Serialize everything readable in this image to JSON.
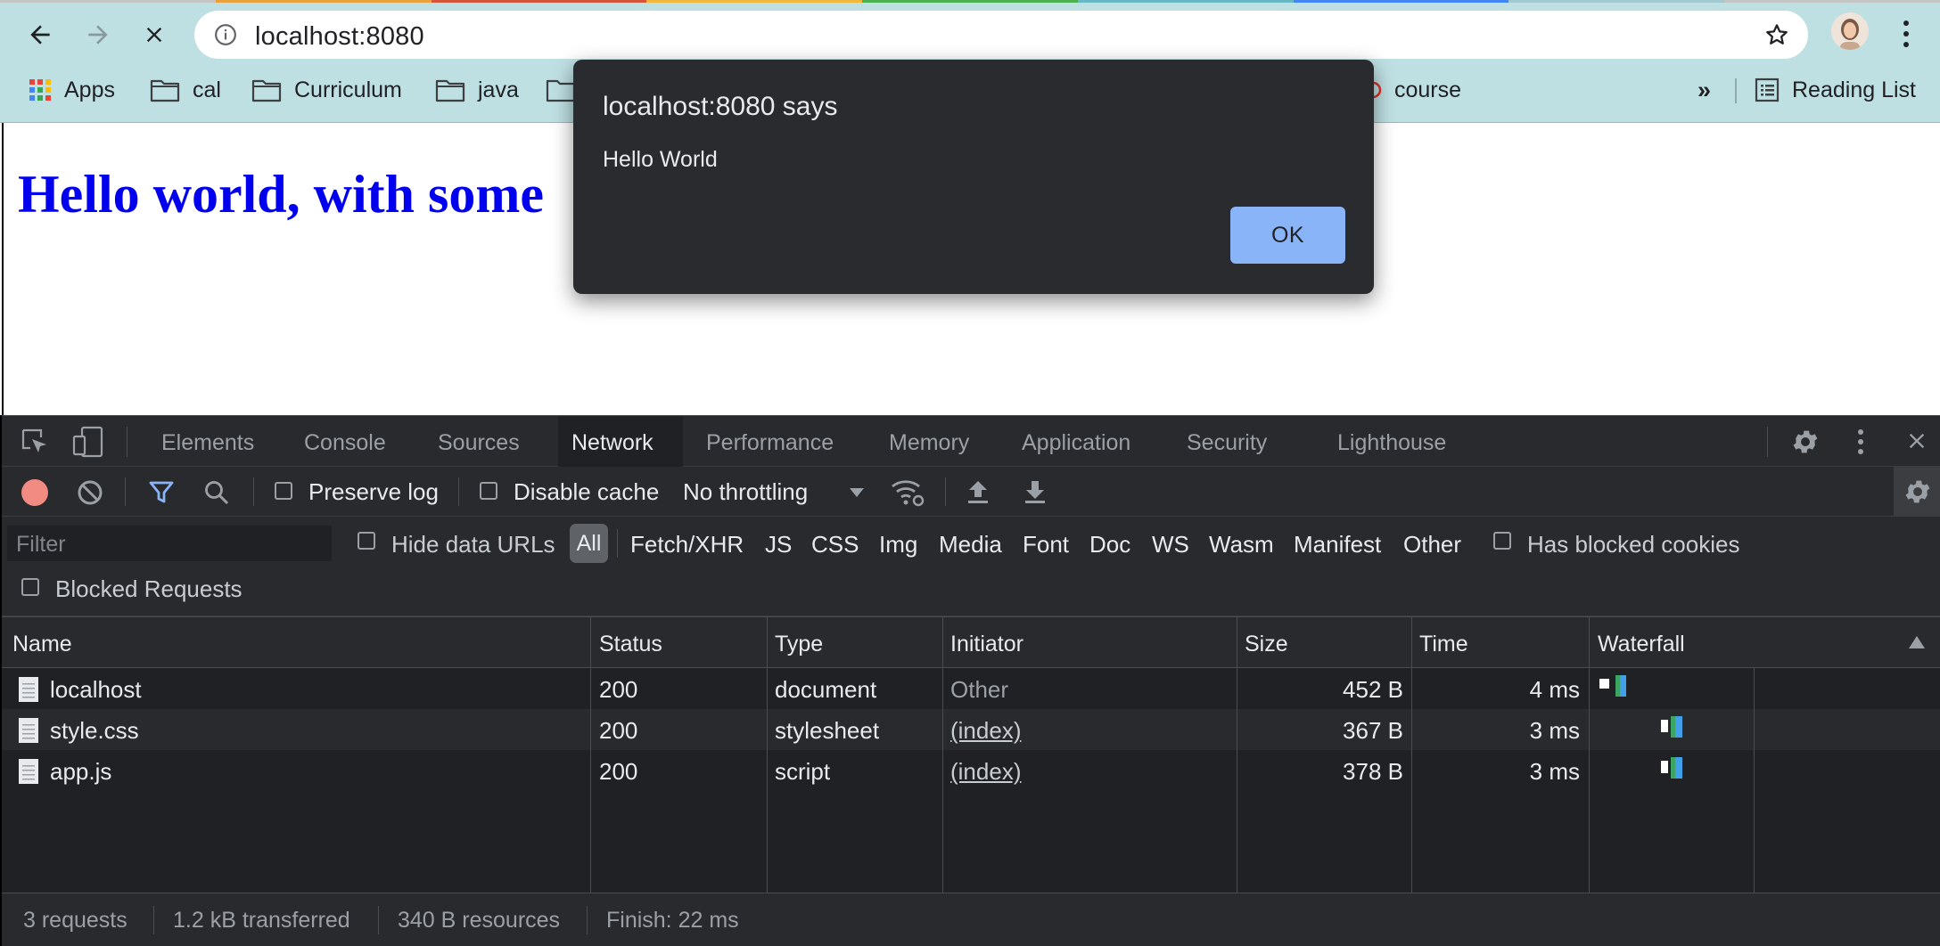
{
  "browser": {
    "url": "localhost:8080",
    "bookmarks": [
      {
        "label": "Apps",
        "icon": "apps-grid-icon"
      },
      {
        "label": "cal",
        "icon": "folder-icon"
      },
      {
        "label": "Curriculum",
        "icon": "folder-icon"
      },
      {
        "label": "java",
        "icon": "folder-icon"
      },
      {
        "label": "course",
        "icon": "bookmark-favicon"
      }
    ],
    "overflow_label": "»",
    "reading_list_label": "Reading List"
  },
  "page": {
    "heading": "Hello world, with some"
  },
  "alert": {
    "title": "localhost:8080 says",
    "message": "Hello World",
    "ok_label": "OK"
  },
  "devtools": {
    "tabs": [
      "Elements",
      "Console",
      "Sources",
      "Network",
      "Performance",
      "Memory",
      "Application",
      "Security",
      "Lighthouse"
    ],
    "active_tab": "Network",
    "toolbar": {
      "preserve_log": "Preserve log",
      "disable_cache": "Disable cache",
      "throttling": "No throttling"
    },
    "filter": {
      "placeholder": "Filter",
      "hide_data_urls": "Hide data URLs",
      "types": [
        "All",
        "Fetch/XHR",
        "JS",
        "CSS",
        "Img",
        "Media",
        "Font",
        "Doc",
        "WS",
        "Wasm",
        "Manifest",
        "Other"
      ],
      "has_blocked_cookies": "Has blocked cookies",
      "blocked_requests": "Blocked Requests"
    },
    "table": {
      "columns": [
        "Name",
        "Status",
        "Type",
        "Initiator",
        "Size",
        "Time",
        "Waterfall"
      ],
      "rows": [
        {
          "name": "localhost",
          "status": "200",
          "type": "document",
          "initiator": "Other",
          "size": "452 B",
          "time": "4 ms"
        },
        {
          "name": "style.css",
          "status": "200",
          "type": "stylesheet",
          "initiator": "(index)",
          "size": "367 B",
          "time": "3 ms"
        },
        {
          "name": "app.js",
          "status": "200",
          "type": "script",
          "initiator": "(index)",
          "size": "378 B",
          "time": "3 ms"
        }
      ]
    },
    "status": {
      "requests": "3 requests",
      "transferred": "1.2 kB transferred",
      "resources": "340 B resources",
      "finish": "Finish: 22 ms"
    }
  },
  "colors": {
    "chrome_bg": "#bfe0e3",
    "link_blue": "#0000ee",
    "alert_ok": "#8ab4f8",
    "record_red": "#f28b82",
    "filter_blue": "#8ab4f8"
  }
}
